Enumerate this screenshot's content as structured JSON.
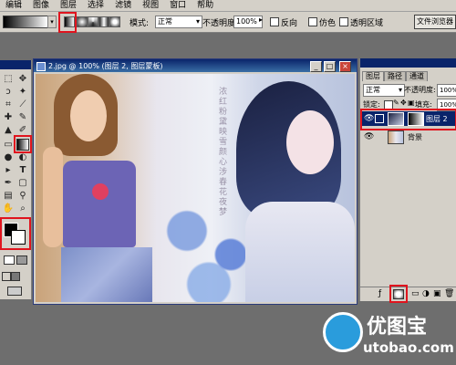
{
  "menu": {
    "items": [
      "编辑",
      "图像",
      "图层",
      "选择",
      "滤镜",
      "视图",
      "窗口",
      "帮助"
    ]
  },
  "options": {
    "mode_label": "模式:",
    "mode_value": "正常",
    "opacity_label": "不透明度:",
    "opacity_value": "100%",
    "reverse_label": "反向",
    "dither_label": "仿色",
    "transparency_label": "透明区域",
    "filebrowser_label": "文件浏览器"
  },
  "document": {
    "title": "2.jpg @ 100% (图层 2, 图层蒙板)",
    "vertical_text": "浓红粉黛映雪颜心涉春花夜梦"
  },
  "layers_panel": {
    "tabs": [
      "图层",
      "路径",
      "通道"
    ],
    "blend_mode": "正常",
    "opacity_label": "不透明度:",
    "opacity_value": "100%",
    "lock_label": "锁定:",
    "fill_label": "填充:",
    "fill_value": "100%",
    "layers": [
      {
        "name": "图层 2",
        "selected": true
      },
      {
        "name": "背景",
        "selected": false
      }
    ]
  },
  "watermark": {
    "brand": "优图宝",
    "url": "utobao.com"
  },
  "colors": {
    "highlight": "#e0141e",
    "selected_layer": "#0a246a",
    "title_bar": "#0a246a"
  }
}
